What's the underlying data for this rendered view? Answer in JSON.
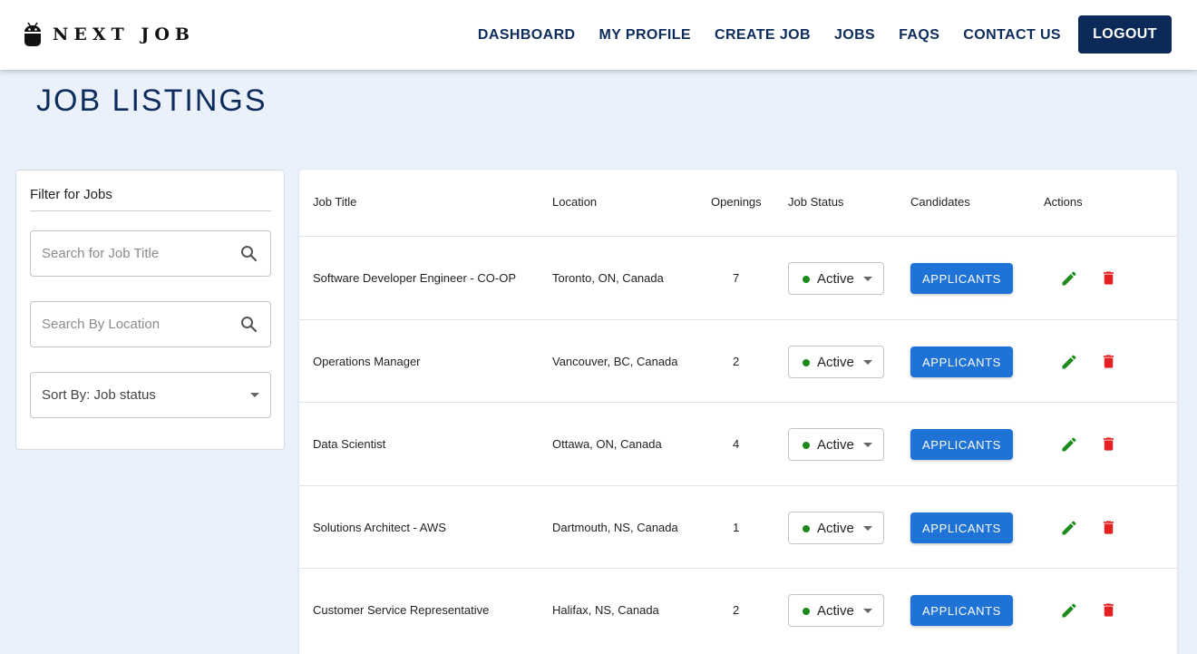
{
  "brand": {
    "name": "NEXT JOB",
    "logo_icon": "android-robot-icon"
  },
  "nav": {
    "links": [
      "DASHBOARD",
      "MY PROFILE",
      "CREATE JOB",
      "JOBS",
      "FAQS",
      "CONTACT US"
    ],
    "logout_label": "LOGOUT"
  },
  "page": {
    "title": "JOB LISTINGS"
  },
  "filter": {
    "title": "Filter for Jobs",
    "title_placeholder": "Search for Job Title",
    "location_placeholder": "Search By Location",
    "sort_label": "Sort By: Job status"
  },
  "table": {
    "headers": [
      "Job Title",
      "Location",
      "Openings",
      "Job Status",
      "Candidates",
      "Actions"
    ],
    "rows": [
      {
        "title": "Software Developer Engineer - CO-OP",
        "location": "Toronto, ON, Canada",
        "openings": "7",
        "status": "Active",
        "candidates_label": "APPLICANTS"
      },
      {
        "title": "Operations Manager",
        "location": "Vancouver, BC, Canada",
        "openings": "2",
        "status": "Active",
        "candidates_label": "APPLICANTS"
      },
      {
        "title": "Data Scientist",
        "location": "Ottawa, ON, Canada",
        "openings": "4",
        "status": "Active",
        "candidates_label": "APPLICANTS"
      },
      {
        "title": "Solutions Architect - AWS",
        "location": "Dartmouth, NS, Canada",
        "openings": "1",
        "status": "Active",
        "candidates_label": "APPLICANTS"
      },
      {
        "title": "Customer Service Representative",
        "location": "Halifax, NS, Canada",
        "openings": "2",
        "status": "Active",
        "candidates_label": "APPLICANTS"
      }
    ]
  },
  "colors": {
    "primary_navy": "#0b2a57",
    "button_blue": "#1f72d6",
    "status_green": "#1b8a1b",
    "edit_green": "#1b8a1b",
    "delete_red": "#e52020",
    "page_background": "#ebf1fb"
  },
  "icons": {
    "search": "search-icon",
    "edit": "pencil-icon",
    "delete": "trash-icon",
    "dropdown": "chevron-down-icon"
  }
}
